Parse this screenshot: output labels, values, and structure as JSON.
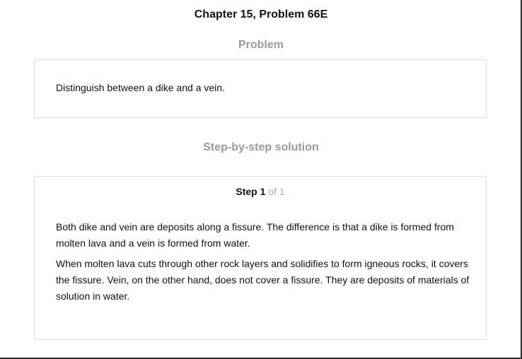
{
  "header": {
    "title": "Chapter 15, Problem 66E"
  },
  "problem": {
    "heading": "Problem",
    "text": "Distinguish between a dike and a vein."
  },
  "solution": {
    "heading": "Step-by-step solution",
    "step_label": "Step 1",
    "step_of": "of 1",
    "paragraphs": [
      "Both dike and vein are deposits along a fissure. The difference is that a dike is formed from molten lava and a vein is formed from water.",
      "When molten lava cuts through other rock layers and solidifies to form igneous rocks, it covers the fissure. Vein, on the other hand, does not cover a fissure. They are deposits of materials of solution in water."
    ]
  }
}
